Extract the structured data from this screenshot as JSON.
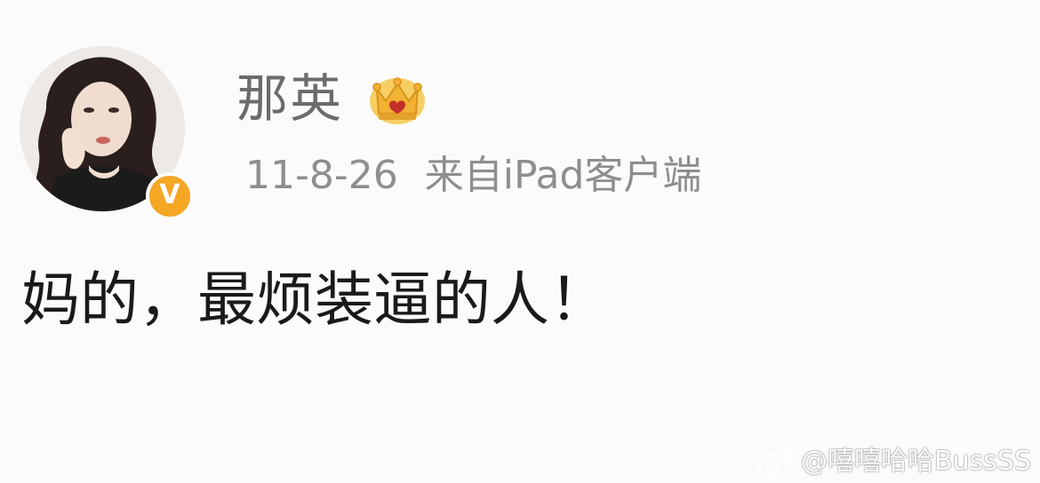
{
  "post": {
    "author": {
      "name": "那英",
      "avatar_icon": "avatar-photo",
      "verified_badge": "V",
      "member_badge_icon": "crown-icon"
    },
    "date": "11-8-26",
    "source": "来自iPad客户端",
    "text": "妈的，最烦装逼的人！"
  },
  "watermark": {
    "logo_icon": "weibo-logo-icon",
    "handle": "@嘻嘻哈哈BussSS"
  },
  "colors": {
    "background": "#fbfbfb",
    "username": "#6b6b6b",
    "meta": "#8e8e8e",
    "text": "#1a1a1a",
    "verified_badge": "#f5a623",
    "crown": "#f2b233"
  }
}
